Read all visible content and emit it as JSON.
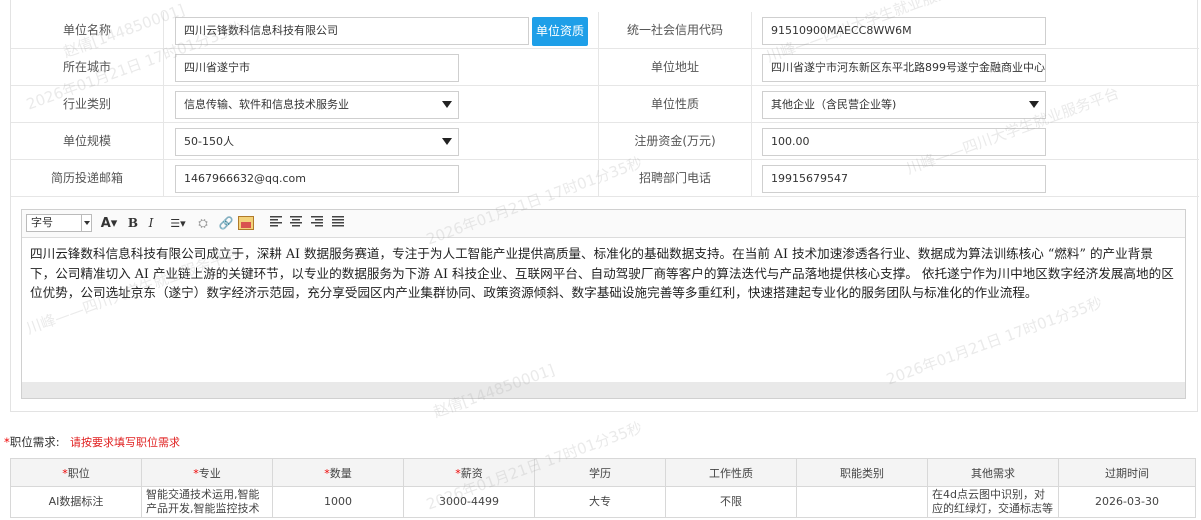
{
  "company": {
    "name_label": "单位名称",
    "name_value": "四川云锋数科信息科技有限公司",
    "qual_button": "单位资质",
    "credit_label": "统一社会信用代码",
    "credit_value": "91510900MAECC8WW6M",
    "city_label": "所在城市",
    "city_value": "四川省遂宁市",
    "address_label": "单位地址",
    "address_value": "四川省遂宁市河东新区东平北路899号遂宁金融商业中心",
    "industry_label": "行业类别",
    "industry_value": "信息传输、软件和信息技术服务业",
    "nature_label": "单位性质",
    "nature_value": "其他企业（含民营企业等)",
    "scale_label": "单位规模",
    "scale_value": "50-150人",
    "capital_label": "注册资金(万元)",
    "capital_value": "100.00",
    "email_label": "简历投递邮箱",
    "email_value": "1467966632@qq.com",
    "phone_label": "招聘部门电话",
    "phone_value": "19915679547"
  },
  "editor": {
    "font_size_label": "字号",
    "content": "四川云锋数科信息科技有限公司成立于，深耕 AI 数据服务赛道，专注于为人工智能产业提供高质量、标准化的基础数据支持。在当前 AI 技术加速渗透各行业、数据成为算法训练核心 “燃料” 的产业背景下，公司精准切入 AI 产业链上游的关键环节，以专业的数据服务为下游 AI 科技企业、互联网平台、自动驾驶厂商等客户的算法迭代与产品落地提供核心支撑。 依托遂宁作为川中地区数字经济发展高地的区位优势，公司选址京东（遂宁）数字经济示范园，充分享受园区内产业集群协同、政策资源倾斜、数字基础设施完善等多重红利，快速搭建起专业化的服务团队与标准化的作业流程。"
  },
  "jobs": {
    "req_star": "*",
    "req_label": "职位需求:",
    "req_tip": "请按要求填写职位需求",
    "headers": [
      {
        "star": "*",
        "text": "职位"
      },
      {
        "star": "*",
        "text": "专业"
      },
      {
        "star": "*",
        "text": "数量"
      },
      {
        "star": "*",
        "text": "薪资"
      },
      {
        "star": "",
        "text": "学历"
      },
      {
        "star": "",
        "text": "工作性质"
      },
      {
        "star": "",
        "text": "职能类别"
      },
      {
        "star": "",
        "text": "其他需求"
      },
      {
        "star": "",
        "text": "过期时间"
      }
    ],
    "rows": [
      {
        "position": "AI数据标注",
        "major": "智能交通技术运用,智能产品开发,智能监控技术应用",
        "count": "1000",
        "salary": "3000-4499",
        "education": "大专",
        "nature": "不限",
        "category": "",
        "other": "在4d点云图中识别，对应的红绿灯，交通标志等",
        "expire": "2026-03-30"
      }
    ]
  },
  "watermark": {
    "line1": "赵倩[144850001]",
    "line2": "川峰——四川大学生就业服务平台",
    "line3": "2026年01月21日 17时01分35秒"
  }
}
